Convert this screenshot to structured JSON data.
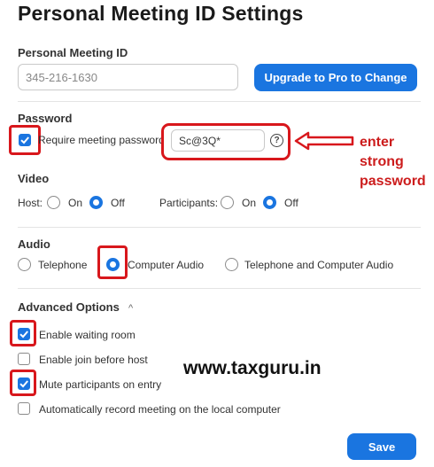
{
  "title": "Personal Meeting ID Settings",
  "pmi": {
    "label": "Personal Meeting ID",
    "value": "345-216-1630",
    "upgrade_button": "Upgrade to Pro to Change"
  },
  "password": {
    "section_label": "Password",
    "require_label": "Require meeting password",
    "require_checked": true,
    "value": "Sc@3Q*",
    "help_icon": "question-circle-icon",
    "help_glyph": "?"
  },
  "video": {
    "section_label": "Video",
    "host_label": "Host:",
    "participants_label": "Participants:",
    "on_label": "On",
    "off_label": "Off",
    "host_selected": "Off",
    "participants_selected": "Off"
  },
  "audio": {
    "section_label": "Audio",
    "options": [
      "Telephone",
      "Computer Audio",
      "Telephone and Computer Audio"
    ],
    "selected": "Computer Audio"
  },
  "advanced": {
    "section_label": "Advanced Options",
    "caret": "^",
    "options": [
      {
        "label": "Enable waiting room",
        "checked": true
      },
      {
        "label": "Enable join before host",
        "checked": false
      },
      {
        "label": "Mute participants on entry",
        "checked": true
      },
      {
        "label": "Automatically record meeting on the local computer",
        "checked": false
      }
    ]
  },
  "save_button": "Save",
  "annotation": {
    "line1": "enter",
    "line2": "strong",
    "line3": "password",
    "color": "#d8171c"
  },
  "watermark": "www.taxguru.in",
  "colors": {
    "accent": "#1a75e0",
    "highlight": "#d8171c"
  }
}
